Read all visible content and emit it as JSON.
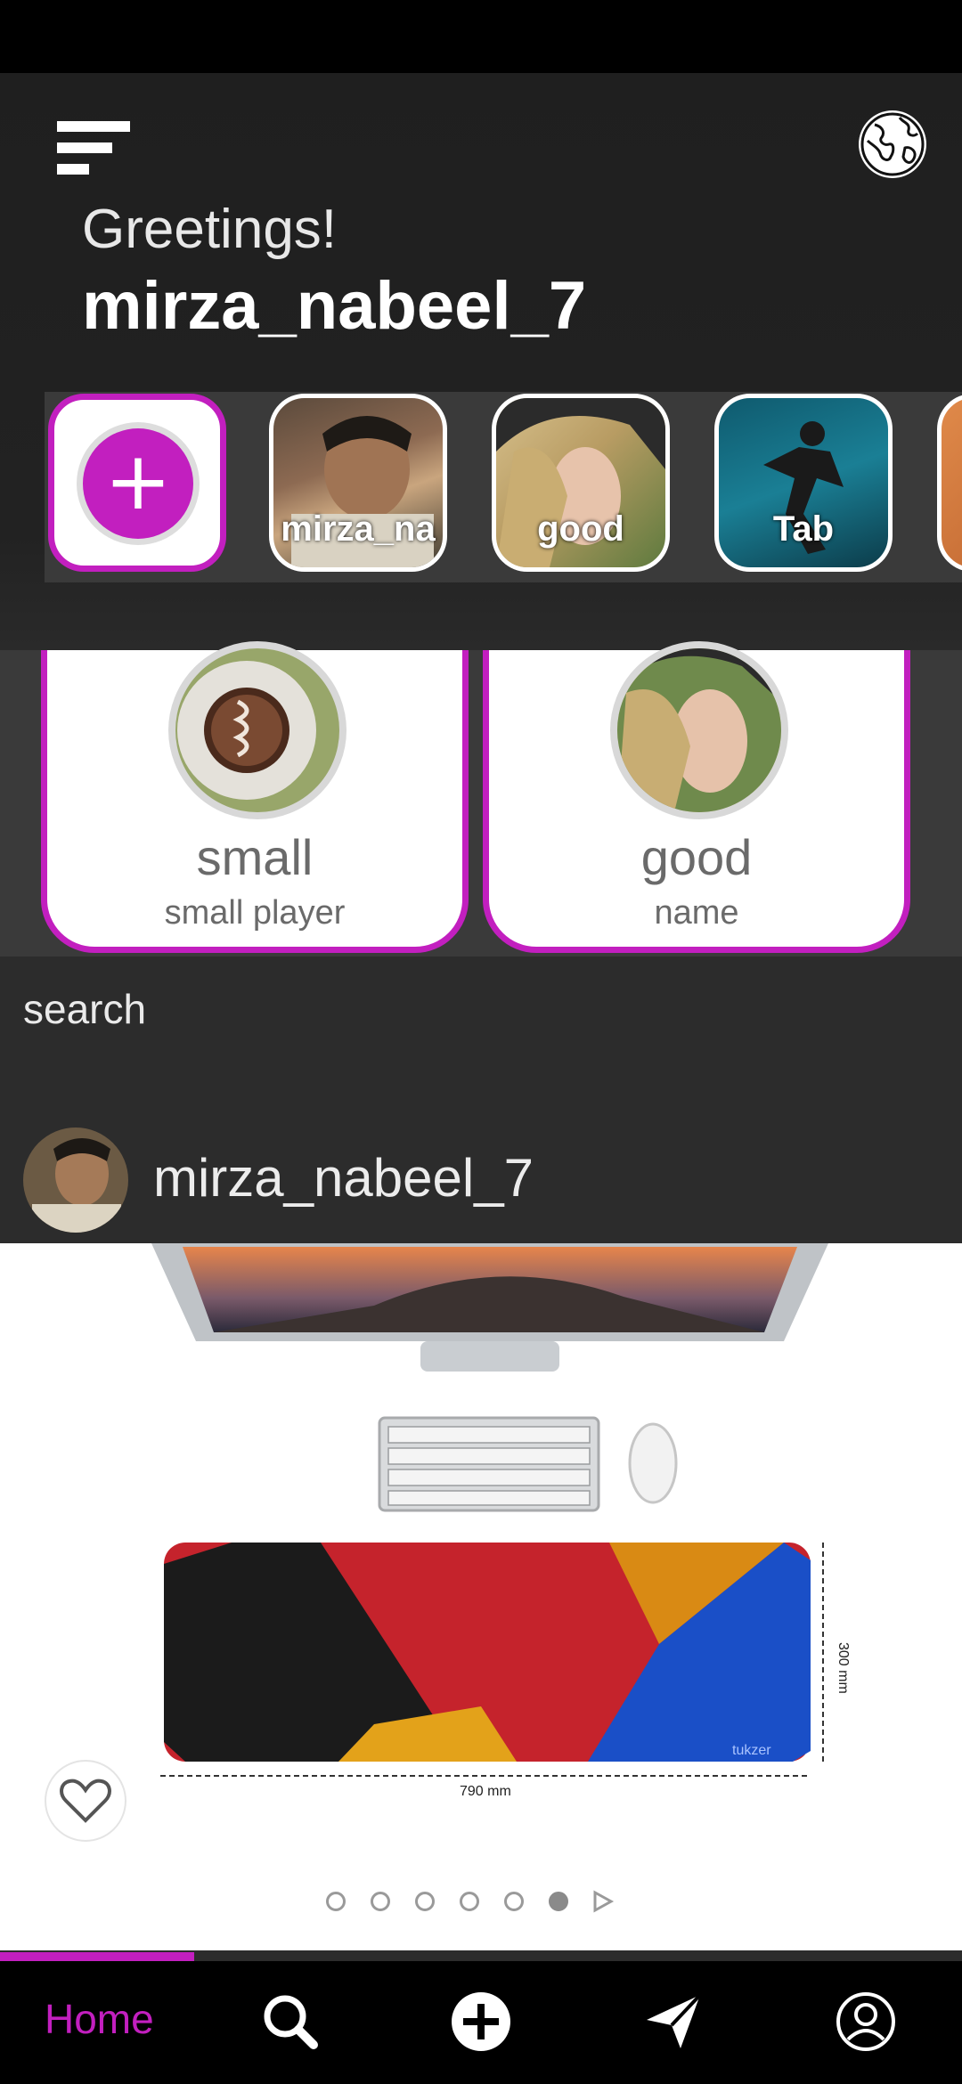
{
  "header": {
    "greeting": "Greetings!",
    "username": "mirza_nabeel_7"
  },
  "stories": [
    {
      "type": "add",
      "icon": "plus-icon"
    },
    {
      "label": "mirza_na"
    },
    {
      "label": "good"
    },
    {
      "label": "Tab"
    }
  ],
  "cards": [
    {
      "title": "small",
      "subtitle": "small player"
    },
    {
      "title": "good",
      "subtitle": "name"
    }
  ],
  "search": {
    "label": "search"
  },
  "post": {
    "username": "mirza_nabeel_7",
    "carousel": {
      "total": 6,
      "active": 6
    },
    "image_caption": "790 mm",
    "image_side_caption": "300 mm",
    "image_brand": "tukzer"
  },
  "nav": {
    "home_label": "Home",
    "items": [
      "search-icon",
      "add-icon",
      "send-icon",
      "profile-icon"
    ]
  },
  "colors": {
    "accent": "#c21fbf",
    "background": "#2c2c2c",
    "nav_background": "#000000"
  }
}
